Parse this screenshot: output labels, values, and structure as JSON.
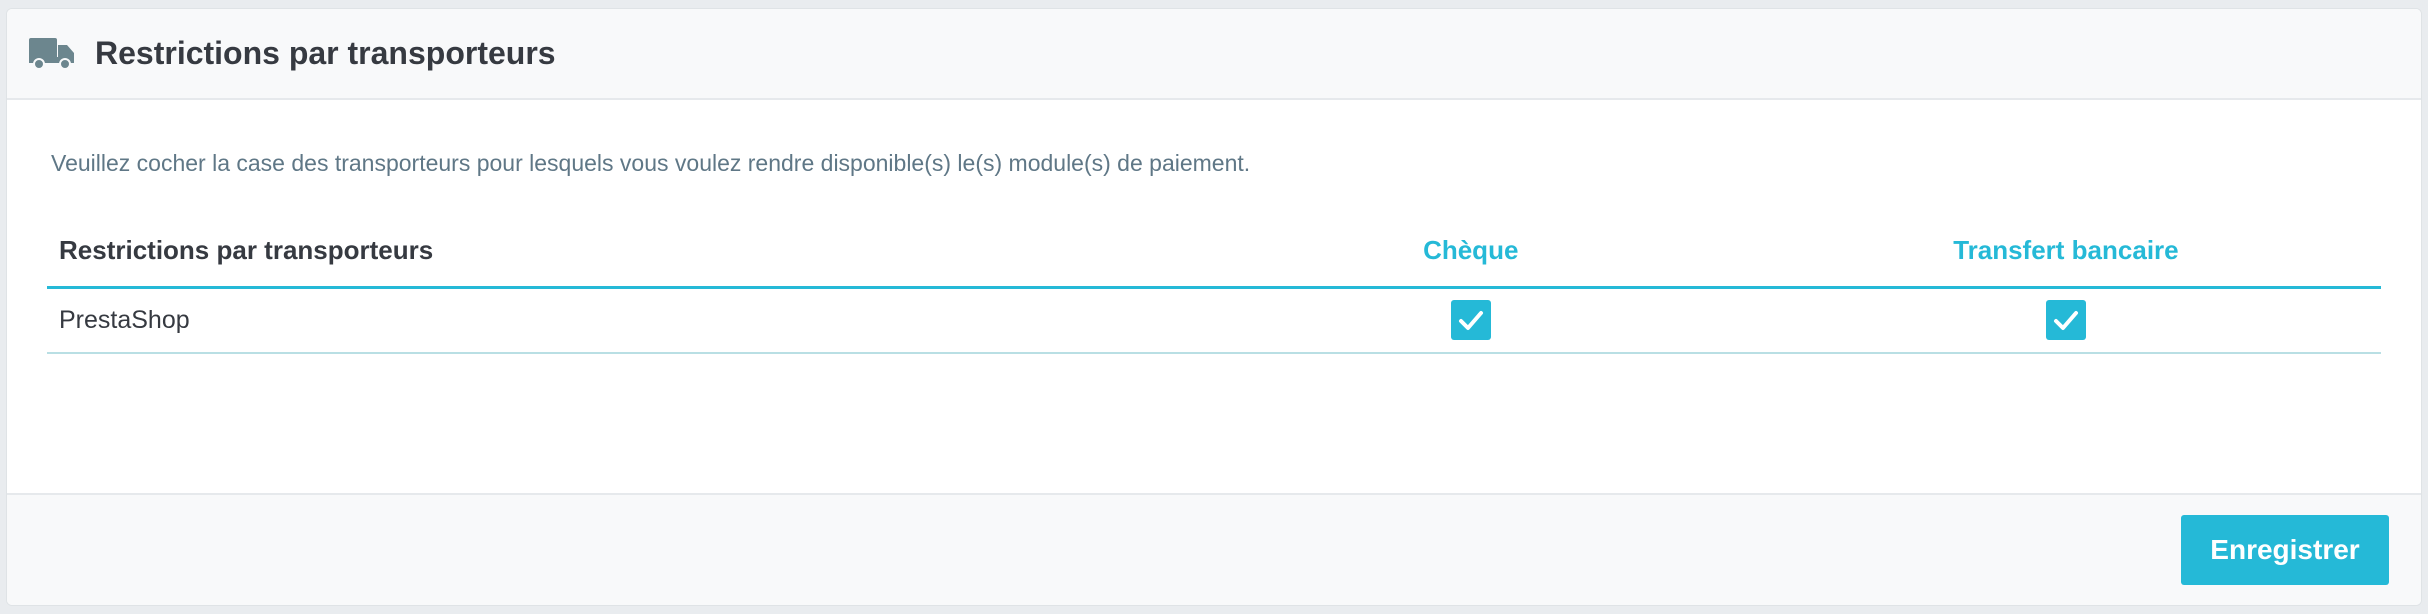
{
  "panel": {
    "icon": "truck-icon",
    "title": "Restrictions par transporteurs"
  },
  "body": {
    "help_text": "Veuillez cocher la case des transporteurs pour lesquels vous voulez rendre disponible(s) le(s) module(s) de paiement."
  },
  "table": {
    "headers": [
      "Restrictions par transporteurs",
      "Chèque",
      "Transfert bancaire"
    ],
    "rows": [
      {
        "carrier": "PrestaShop",
        "cheque": true,
        "transfert": true
      }
    ]
  },
  "footer": {
    "save_label": "Enregistrer"
  },
  "colors": {
    "accent": "#25b9d7",
    "title": "#363a41",
    "help": "#5f7786"
  }
}
